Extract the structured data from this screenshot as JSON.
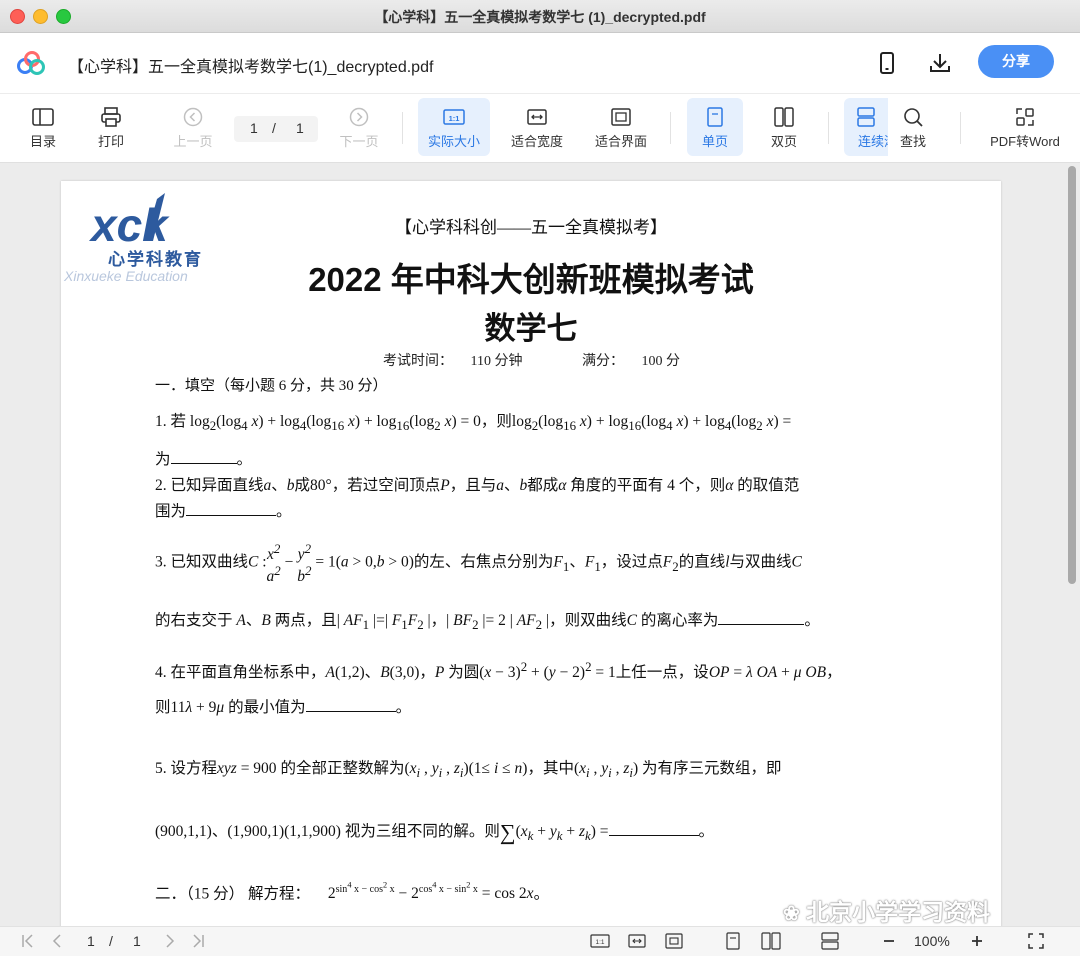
{
  "window": {
    "title": "【心学科】五一全真模拟考数学七 (1)_decrypted.pdf"
  },
  "header": {
    "doc_name": "【心学科】五一全真模拟考数学七(1)_decrypted.pdf",
    "share_label": "分享"
  },
  "toolbar": {
    "toc": "目录",
    "print": "打印",
    "prev": "上一页",
    "current_page": "1",
    "slash": "/",
    "total_pages": "1",
    "next": "下一页",
    "actual_size": "实际大小",
    "fit_width": "适合宽度",
    "fit_page": "适合界面",
    "single": "单页",
    "double": "双页",
    "continuous": "连续滚",
    "find": "查找",
    "pdf_to_word": "PDF转Word"
  },
  "document": {
    "logo_letters": "XXK",
    "logo_cn": "心学科教育",
    "logo_en": "Xinxueke Education",
    "header": "【心学科科创——五一全真模拟考】",
    "title": "2022 年中科大创新班模拟考试",
    "subtitle": "数学七",
    "exam_time_label": "考试时间：",
    "exam_time": "110 分钟",
    "full_score_label": "满分：",
    "full_score": "100 分",
    "section1": "一．填空（每小题 6 分，共 30 分）",
    "q1_a": "1.   若",
    "q1_b": "，则",
    "q1_c": "为",
    "q2": "2.   已知异面直线",
    "q2_b": "成80°，若过空间顶点",
    "q2_c": "，且与",
    "q2_d": "都成",
    "q2_e": "角度的平面有 4 个，则",
    "q2_f": "的取值范",
    "q2_g": "围为",
    "q3_a": "3.   已知双曲线",
    "q3_b": "的左、右焦点分别为",
    "q3_c": "，设过点",
    "q3_d": "的直线",
    "q3_e": "与双曲线",
    "q3_f": "的右支交于",
    "q3_g": "两点，且",
    "q3_h": "，则双曲线",
    "q3_i": "的离心率为",
    "q4_a": "4.   在平面直角坐标系中，",
    "q4_b": "为圆",
    "q4_c": "上任一点，设",
    "q4_d": "则",
    "q4_e": "的最小值为",
    "q5_a": "5.   设方程",
    "q5_b": "的全部正整数解为",
    "q5_c": "，其中",
    "q5_d": "为有序三元数组，即",
    "q5_e": "视为三组不同的解。则",
    "section2": "二．（15 分）  解方程：",
    "period": "。"
  },
  "watermark": "北京小学学习资料",
  "bottombar": {
    "page": "1",
    "slash": "/",
    "total": "1",
    "zoom": "100%"
  }
}
